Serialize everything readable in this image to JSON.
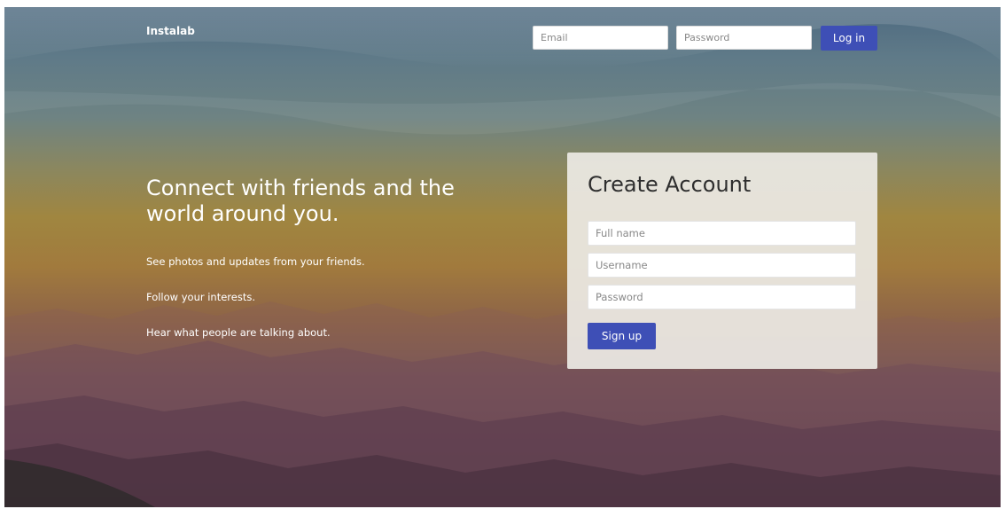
{
  "header": {
    "brand": "Instalab",
    "email_placeholder": "Email",
    "password_placeholder": "Password",
    "login_label": "Log in"
  },
  "hero": {
    "headline": "Connect with friends and the world around you.",
    "taglines": [
      "See photos and updates from your friends.",
      "Follow your interests.",
      "Hear what people are talking about."
    ]
  },
  "signup": {
    "title": "Create Account",
    "fullname_placeholder": "Full name",
    "username_placeholder": "Username",
    "password_placeholder": "Password",
    "button_label": "Sign up"
  },
  "colors": {
    "accent": "#3e4fb6",
    "card_background": "#eceae4"
  }
}
